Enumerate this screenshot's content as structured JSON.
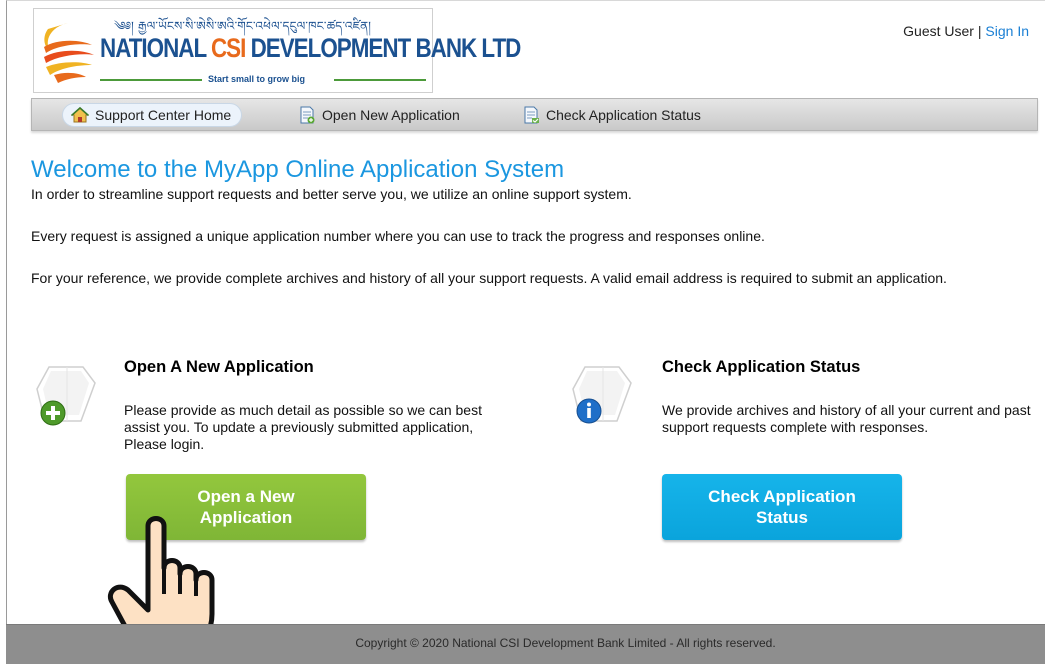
{
  "header": {
    "logo_script": "༄༅། རྒྱལ་ཡོངས་སི་ཨེསི་ཨའི་གོང་འཕེལ་དངུལ་ཁང་ཚད་འཛིན།",
    "logo_name_part1": "NATIONAL ",
    "logo_name_csi": "CSI",
    "logo_name_part2": " DEVELOPMENT BANK LTD",
    "logo_tagline": "Start small to grow big",
    "user_label": "Guest User",
    "separator": " | ",
    "sign_in": "Sign In"
  },
  "nav": {
    "items": [
      {
        "label": "Support Center Home",
        "icon": "home-icon"
      },
      {
        "label": "Open New Application",
        "icon": "new-ticket-icon"
      },
      {
        "label": "Check Application Status",
        "icon": "ticket-status-icon"
      }
    ]
  },
  "main": {
    "title": "Welcome to the MyApp Online Application System",
    "paragraphs": [
      "In order to streamline support requests and better serve you, we utilize an online support system.",
      "Every request is assigned a unique application number where you can use to track the progress and responses online.",
      "For your reference, we provide complete archives and history of all your support requests. A valid email address is required to submit an application."
    ]
  },
  "cards": {
    "open": {
      "title": "Open A New Application",
      "text": "Please provide as much detail as possible so we can best assist you. To update a previously submitted application, Please login.",
      "button": "Open a New Application",
      "icon": "new-application-icon",
      "accent": "#8bc34a"
    },
    "status": {
      "title": "Check Application Status",
      "text": "We provide archives and history of all your current and past support requests complete with responses.",
      "button": "Check Application Status",
      "icon": "application-status-icon",
      "accent": "#10acE3"
    }
  },
  "footer": {
    "copyright": "Copyright © 2020 National CSI Development Bank Limited - All rights reserved."
  },
  "colors": {
    "title_blue": "#1b97e0",
    "link_blue": "#1a7fd4",
    "brand_blue": "#1b5190",
    "brand_orange": "#e86a1c"
  }
}
